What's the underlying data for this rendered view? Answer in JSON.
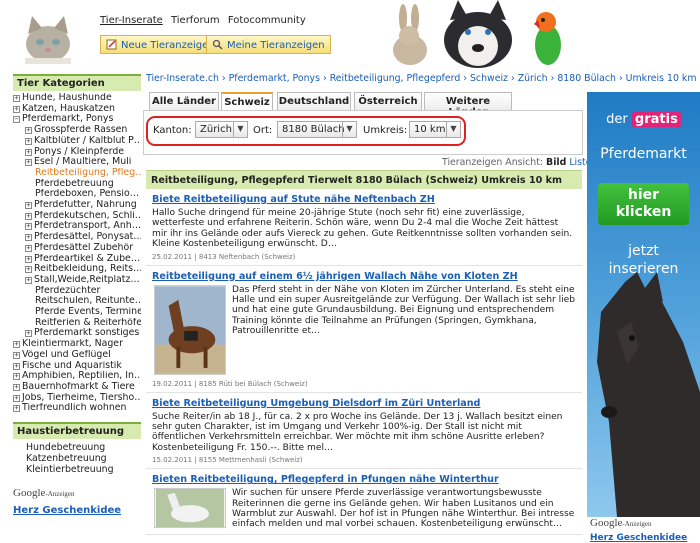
{
  "header": {
    "nav": [
      "Tier-Inserate",
      "Tierforum",
      "Fotocommunity"
    ],
    "btn_new": "Neue Tieranzeige",
    "btn_mine": "Meine Tieranzeigen"
  },
  "sidebar": {
    "heading": "Tier Kategorien",
    "items": [
      {
        "pm": "+",
        "label": "Hunde, Haushunde",
        "indent": 0
      },
      {
        "pm": "+",
        "label": "Katzen, Hauskatzen",
        "indent": 0
      },
      {
        "pm": "−",
        "label": "Pferdemarkt, Ponys",
        "indent": 0
      },
      {
        "pm": "+",
        "label": "Grosspferde Rassen",
        "indent": 1
      },
      {
        "pm": "+",
        "label": "Kaltblüter / Kaltblut P…",
        "indent": 1
      },
      {
        "pm": "+",
        "label": "Ponys / Kleinpferde",
        "indent": 1
      },
      {
        "pm": "+",
        "label": "Esel / Maultiere, Muli",
        "indent": 1
      },
      {
        "pm": "",
        "label": "Reitbeteiligung, Pfleg…",
        "indent": 2,
        "selected": true
      },
      {
        "pm": "",
        "label": "Pferdebetreuung",
        "indent": 2
      },
      {
        "pm": "",
        "label": "Pferdeboxen, Pensio…",
        "indent": 2
      },
      {
        "pm": "+",
        "label": "Pferdefutter, Nahrung",
        "indent": 1
      },
      {
        "pm": "+",
        "label": "Pferdekutschen, Schli…",
        "indent": 1
      },
      {
        "pm": "+",
        "label": "Pferdetransport, Anh…",
        "indent": 1
      },
      {
        "pm": "+",
        "label": "Pferdesättel, Ponysat…",
        "indent": 1
      },
      {
        "pm": "+",
        "label": "Pferdesättel Zubehör",
        "indent": 1
      },
      {
        "pm": "+",
        "label": "Pferdeartikel & Zube…",
        "indent": 1
      },
      {
        "pm": "+",
        "label": "Reitbekleidung, Reits…",
        "indent": 1
      },
      {
        "pm": "+",
        "label": "Stall,Weide,Reitplatz…",
        "indent": 1
      },
      {
        "pm": "",
        "label": "Pferdezüchter",
        "indent": 2
      },
      {
        "pm": "",
        "label": "Reitschulen, Reitunte…",
        "indent": 2
      },
      {
        "pm": "",
        "label": "Pferde Events, Termine",
        "indent": 2
      },
      {
        "pm": "",
        "label": "Reitferien & Reiterhöfe",
        "indent": 2
      },
      {
        "pm": "+",
        "label": "Pferdemarkt sonstiges",
        "indent": 1
      },
      {
        "pm": "+",
        "label": "Kleintiermarkt, Nager",
        "indent": 0
      },
      {
        "pm": "+",
        "label": "Vögel und Geflügel",
        "indent": 0
      },
      {
        "pm": "+",
        "label": "Fische und Aquaristik",
        "indent": 0
      },
      {
        "pm": "+",
        "label": "Amphibien, Reptilien, In…",
        "indent": 0
      },
      {
        "pm": "+",
        "label": "Bauernhofmarkt & Tiere",
        "indent": 0
      },
      {
        "pm": "+",
        "label": "Jobs, Tierheime, Tiersho…",
        "indent": 0
      },
      {
        "pm": "+",
        "label": "Tierfreundlich wohnen",
        "indent": 0
      }
    ],
    "heading2": "Haustierbetreuung",
    "items2": [
      "Hundebetreuung",
      "Katzenbetreuung",
      "Kleintierbetreuung"
    ],
    "google": "Google",
    "google_small": "-Anzeigen",
    "ad_link": "Herz Geschenkidee"
  },
  "breadcrumb": "Tier-Inserate.ch › Pferdemarkt, Ponys › Reitbeteiligung, Pflegepferd › Schweiz › Zürich › 8180 Bülach › Umkreis 10 km",
  "tabs": [
    "Alle Länder",
    "Schweiz",
    "Deutschland",
    "Österreich",
    "Weitere Länder"
  ],
  "filters": {
    "kanton_label": "Kanton:",
    "kanton_value": "Zürich",
    "ort_label": "Ort:",
    "ort_value": "8180 Bülach",
    "umkreis_label": "Umkreis:",
    "umkreis_value": "10 km"
  },
  "view": {
    "label": "Tieranzeigen Ansicht:",
    "bild": "Bild",
    "liste": "Liste"
  },
  "results": {
    "heading": "Reitbeteiligung, Pflegepferd Tierwelt 8180 Bülach (Schweiz) Umkreis 10 km",
    "items": [
      {
        "title": "Biete Reitbeteiligung auf Stute nähe Neftenbach ZH",
        "text": "Hallo Suche dringend für meine 20-jährige Stute (noch sehr fit) eine zuverlässige, wetterfeste und erfahrene Reiterin. Schön wäre, wenn Du 2-4 mal die Woche Zeit hättest mir ihr ins Gelände oder aufs Viereck zu gehen. Gute Reitkenntnisse sollten vorhanden sein. Kleine Kostenbeteiligung erwünscht. D…",
        "meta": "25.02.2011 | 8413 Neftenbach (Schweiz)"
      },
      {
        "title": "Reitbeteiligung auf einem 6½ jährigen Wallach Nähe von Kloten ZH",
        "text": "Das Pferd steht in der Nähe von Kloten im Zürcher Unterland. Es steht eine Halle und ein super Ausreitgelände zur Verfügung. Der Wallach ist sehr lieb und hat eine gute Grundausbildung. Bei Eignung und entsprechendem Training könnte die Teilnahme an Prüfungen (Springen, Gymkhana, Patrouillenritte et…",
        "meta": "19.02.2011 | 8185 Rüti bei Bülach (Schweiz)"
      },
      {
        "title": "Biete Reitbeteiligung Umgebung Dielsdorf im Züri Unterland",
        "text": "Suche Reiter/in ab 18 J., für ca. 2 x pro Woche ins Gelände. Der 13 j. Wallach besitzt einen sehr guten Charakter, ist im Umgang und Verkehr 100%-ig. Der Stall ist nicht mit öffentlichen Verkehrsmitteln erreichbar. Wer möchte mit ihm schöne Ausritte erleben? Kostenbeteiligung Fr. 150.--. Bitte mel…",
        "meta": "15.02.2011 | 8155 Mettmenhasli (Schweiz)"
      },
      {
        "title": "Bieten Reitbeteiligung, Pflegepferd in Pfungen nähe Winterthur",
        "text": "Wir suchen für unsere Pferde zuverlässige verantwortungsbewusste Reiterinnen die gerne ins Gelände gehen. Wir haben Lusitanos und ein Warmblut zur Auswahl. Der hof ist in Pfungen nähe Winterthur. Bei intresse einfach melden und mal vorbei schauen. Kostenbeteiligung erwünscht…",
        "meta": ""
      }
    ]
  },
  "ad": {
    "der": "der",
    "gratis": "gratis",
    "pferdemarkt": "Pferdemarkt",
    "btn_line1": "hier",
    "btn_line2": "klicken",
    "jetzt": "jetzt",
    "inserieren": "inserieren",
    "google": "Google",
    "google_small": "-Anzeigen",
    "link": "Herz Geschenkidee"
  }
}
